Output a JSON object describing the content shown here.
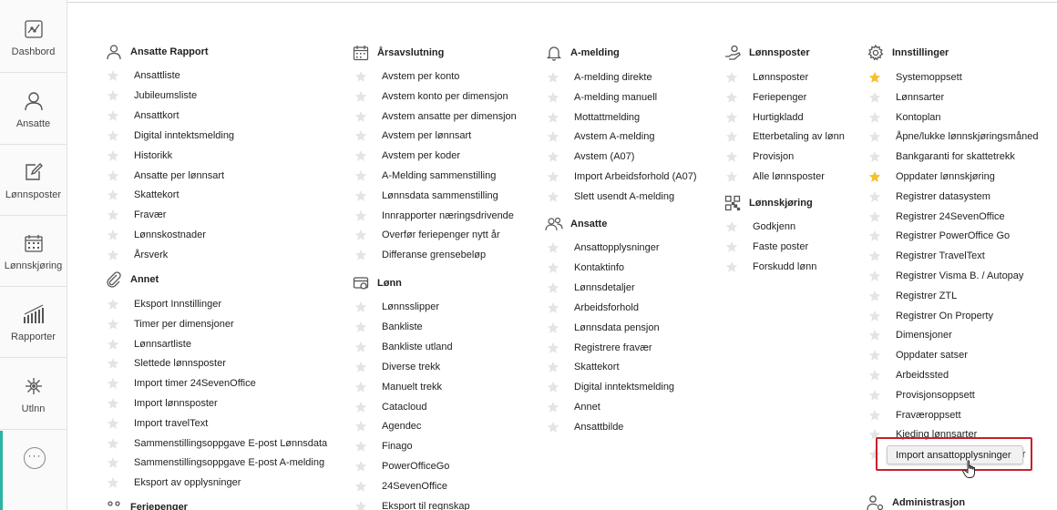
{
  "sidebar": {
    "items": [
      {
        "label": "Dashbord",
        "icon": "dashboard-icon"
      },
      {
        "label": "Ansatte",
        "icon": "person-icon"
      },
      {
        "label": "Lønnsposter",
        "icon": "edit-icon"
      },
      {
        "label": "Lønnskjøring",
        "icon": "calendar-icon"
      },
      {
        "label": "Rapporter",
        "icon": "bar-chart-icon"
      },
      {
        "label": "Utlnn",
        "icon": "network-icon"
      }
    ],
    "more": "···"
  },
  "columns": {
    "c1": {
      "ansatte_rapport": {
        "title": "Ansatte Rapport",
        "items": [
          "Ansattliste",
          "Jubileumsliste",
          "Ansattkort",
          "Digital inntektsmelding",
          "Historikk",
          "Ansatte per lønnsart",
          "Skattekort",
          "Fravær",
          "Lønnskostnader",
          "Årsverk"
        ]
      },
      "annet": {
        "title": "Annet",
        "items": [
          "Eksport Innstillinger",
          "Timer per dimensjoner",
          "Lønnsartliste",
          "Slettede lønnsposter",
          "Import timer 24SevenOffice",
          "Import lønnsposter",
          "Import travelText",
          "Sammenstillingsoppgave E-post Lønnsdata",
          "Sammenstillingsoppgave E-post A-melding",
          "Eksport av opplysninger"
        ]
      },
      "feriepenger": {
        "title": "Feriepenger"
      }
    },
    "c2": {
      "arsavslutning": {
        "title": "Årsavslutning",
        "items": [
          "Avstem per konto",
          "Avstem konto per dimensjon",
          "Avstem ansatte per dimensjon",
          "Avstem per lønnsart",
          "Avstem per koder",
          "A-Melding sammenstilling",
          "Lønnsdata sammenstilling",
          "Innrapporter næringsdrivende",
          "Overfør feriepenger nytt år",
          "Differanse grensebeløp"
        ]
      },
      "lonn": {
        "title": "Lønn",
        "items": [
          "Lønnsslipper",
          "Bankliste",
          "Bankliste utland",
          "Diverse trekk",
          "Manuelt trekk",
          "Catacloud",
          "Agendec",
          "Finago",
          "PowerOfficeGo",
          "24SevenOffice",
          "Eksport til regnskap"
        ]
      }
    },
    "c3": {
      "amelding": {
        "title": "A-melding",
        "items": [
          "A-melding direkte",
          "A-melding manuell",
          "Mottattmelding",
          "Avstem A-melding",
          "Avstem (A07)",
          "Import Arbeidsforhold (A07)",
          "Slett usendt A-melding"
        ]
      },
      "ansatte": {
        "title": "Ansatte",
        "items": [
          "Ansattopplysninger",
          "Kontaktinfo",
          "Lønnsdetaljer",
          "Arbeidsforhold",
          "Lønnsdata pensjon",
          "Registrere fravær",
          "Skattekort",
          "Digital inntektsmelding",
          "Annet",
          "Ansattbilde"
        ]
      }
    },
    "c4": {
      "lonnsposter": {
        "title": "Lønnsposter",
        "items": [
          "Lønnsposter",
          "Feriepenger",
          "Hurtigkladd",
          "Etterbetaling av lønn",
          "Provisjon",
          "Alle lønnsposter"
        ]
      },
      "lonnskjoring": {
        "title": "Lønnskjøring",
        "items": [
          "Godkjenn",
          "Faste poster",
          "Forskudd lønn"
        ]
      }
    },
    "c5": {
      "innstillinger": {
        "title": "Innstillinger",
        "items": [
          "Systemoppsett",
          "Lønnsarter",
          "Kontoplan",
          "Åpne/lukke lønnskjøringsmåned",
          "Bankgaranti for skattetrekk",
          "Oppdater lønnskjøring",
          "Registrer datasystem",
          "Registrer 24SevenOffice",
          "Registrer PowerOffice Go",
          "Registrer TravelText",
          "Registrer Visma B. / Autopay",
          "Registrer ZTL",
          "Registrer On Property",
          "Dimensjoner",
          "Oppdater satser",
          "Arbeidssted",
          "Provisjonsoppsett",
          "Fraværoppsett",
          "Kjeding lønnsarter",
          "Masseoppdater ansattverdier"
        ],
        "starred": [
          0,
          5
        ]
      },
      "administrasjon": {
        "title": "Administrasjon"
      }
    }
  },
  "tooltip": "Import ansattopplysninger",
  "colors": {
    "star_inactive": "#e4e4e4",
    "star_active": "#f5c02e",
    "highlight": "#c8202a",
    "accent": "#2bb3a3"
  }
}
